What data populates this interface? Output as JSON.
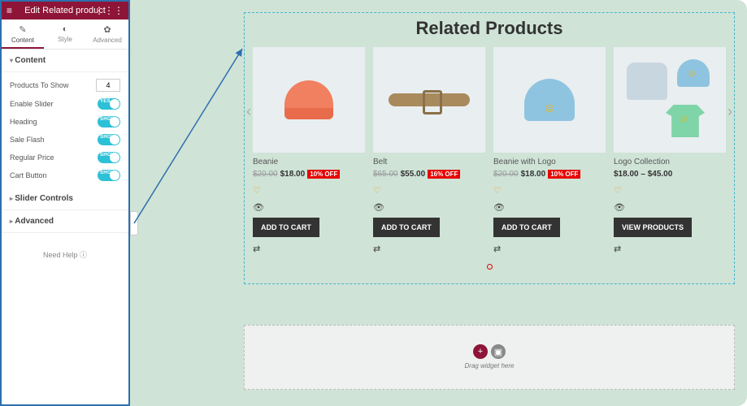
{
  "header": {
    "title": "Edit Related product"
  },
  "tabs": [
    {
      "label": "Content",
      "icon": "✎"
    },
    {
      "label": "Style",
      "icon": "◐"
    },
    {
      "label": "Advanced",
      "icon": "✿"
    }
  ],
  "sections": {
    "content": {
      "title": "Content",
      "products_to_show": {
        "label": "Products To Show",
        "value": "4"
      },
      "toggles": [
        {
          "label": "Enable Slider",
          "state": "YES"
        },
        {
          "label": "Heading",
          "state": "SHOW"
        },
        {
          "label": "Sale Flash",
          "state": "SHOW"
        },
        {
          "label": "Regular Price",
          "state": "SHOW"
        },
        {
          "label": "Cart Button",
          "state": "SHOW"
        }
      ]
    },
    "slider_controls": {
      "title": "Slider Controls"
    },
    "advanced": {
      "title": "Advanced"
    }
  },
  "need_help": "Need Help ⓘ",
  "widget": {
    "title": "Related Products",
    "products": [
      {
        "name": "Beanie",
        "old_price": "$20.00",
        "new_price": "$18.00",
        "discount": "10% OFF",
        "button": "ADD TO CART"
      },
      {
        "name": "Belt",
        "old_price": "$65.00",
        "new_price": "$55.00",
        "discount": "16% OFF",
        "button": "ADD TO CART"
      },
      {
        "name": "Beanie with Logo",
        "old_price": "$20.00",
        "new_price": "$18.00",
        "discount": "10% OFF",
        "button": "ADD TO CART"
      },
      {
        "name": "Logo Collection",
        "price_range": "$18.00 – $45.00",
        "button": "VIEW PRODUCTS"
      }
    ]
  },
  "dropzone": {
    "text": "Drag widget\nhere"
  }
}
